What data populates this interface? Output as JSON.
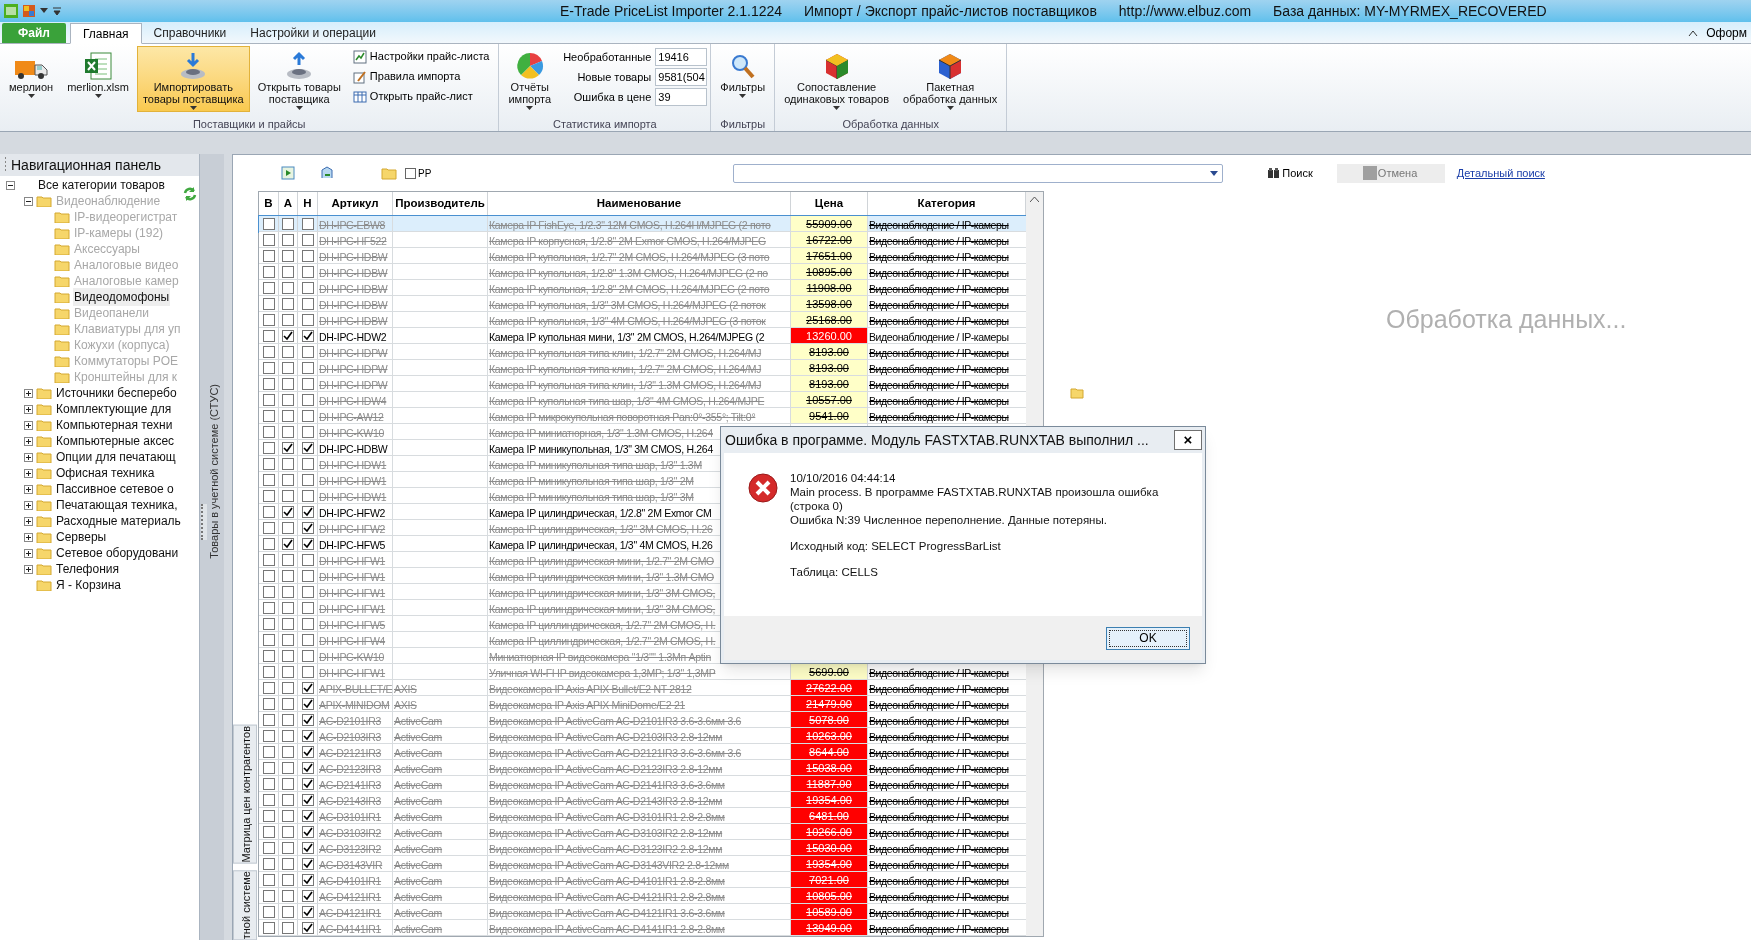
{
  "window": {
    "title_parts": [
      "E-Trade PriceList Importer 2.1.1224",
      "Импорт / Экспорт прайс-листов поставщиков",
      "http://www.elbuz.com",
      "База данных: MY-MYRMEX_RECOVERED"
    ]
  },
  "ribbon_tabs": [
    {
      "label": "Файл",
      "kind": "file",
      "selected": false
    },
    {
      "label": "Главная",
      "kind": "tab",
      "selected": true
    },
    {
      "label": "Справочники",
      "kind": "tab",
      "selected": false
    },
    {
      "label": "Настройки и операции",
      "kind": "tab",
      "selected": false
    }
  ],
  "ribbon_right": "Оформ",
  "ribbon_groups": [
    {
      "label": "Поставщики и прайсы",
      "items": [
        {
          "kind": "large",
          "label": "мерлион",
          "dropdown": true,
          "highlighted": false
        },
        {
          "kind": "large",
          "label": "merlion.xlsm",
          "dropdown": true,
          "highlighted": false
        },
        {
          "kind": "large",
          "label": "Импортировать\nтовары поставщика",
          "dropdown": true,
          "highlighted": true
        },
        {
          "kind": "large",
          "label": "Открыть товары\nпоставщика",
          "dropdown": true,
          "highlighted": false
        },
        {
          "kind": "small_stack",
          "entries": [
            "Настройки прайс-листа",
            "Правила импорта",
            "Открыть прайс-лист"
          ]
        }
      ]
    },
    {
      "label": "Статистика импорта",
      "items": [
        {
          "kind": "large",
          "label": "Отчёты\nимпорта",
          "dropdown": true,
          "highlighted": false
        },
        {
          "kind": "stats",
          "fields": [
            {
              "label": "Необработанные",
              "value": "19416"
            },
            {
              "label": "Новые товары",
              "value": "9581(504"
            },
            {
              "label": "Ошибка в цене",
              "value": "39"
            }
          ]
        }
      ]
    },
    {
      "label": "Фильтры",
      "items": [
        {
          "kind": "large",
          "label": "Фильтры",
          "dropdown": true,
          "highlighted": false
        }
      ]
    },
    {
      "label": "Обработка данных",
      "items": [
        {
          "kind": "large",
          "label": "Сопоставление\nодинаковых товаров",
          "dropdown": true,
          "highlighted": false
        },
        {
          "kind": "large",
          "label": "Пакетная\nобработка данных",
          "dropdown": true,
          "highlighted": false
        }
      ]
    }
  ],
  "nav": {
    "title": "Навигационная панель",
    "tree": [
      {
        "label": "Все категории товаров",
        "kind": "group",
        "expanded": true,
        "disabled": false,
        "selected": false,
        "children": [
          {
            "label": "Видеонаблюдение",
            "kind": "group",
            "expanded": true,
            "disabled": true,
            "selected": false,
            "children": [
              {
                "label": "IP-видеорегистрат",
                "kind": "leaf",
                "disabled": true,
                "selected": false
              },
              {
                "label": "IP-камеры (192)",
                "kind": "leaf",
                "disabled": true,
                "selected": false
              },
              {
                "label": "Аксессуары",
                "kind": "leaf",
                "disabled": true,
                "selected": false
              },
              {
                "label": "Аналоговые видео",
                "kind": "leaf",
                "disabled": true,
                "selected": false
              },
              {
                "label": "Аналоговые камер",
                "kind": "leaf",
                "disabled": true,
                "selected": false
              },
              {
                "label": "Видеодомофоны",
                "kind": "leaf",
                "disabled": false,
                "selected": true
              },
              {
                "label": "Видеопанели",
                "kind": "leaf",
                "disabled": true,
                "selected": false
              },
              {
                "label": "Клавиатуры для уп",
                "kind": "leaf",
                "disabled": true,
                "selected": false
              },
              {
                "label": "Кожухи (корпуса)",
                "kind": "leaf",
                "disabled": true,
                "selected": false
              },
              {
                "label": "Коммутаторы POE",
                "kind": "leaf",
                "disabled": true,
                "selected": false
              },
              {
                "label": "Кронштейны для к",
                "kind": "leaf",
                "disabled": true,
                "selected": false
              }
            ]
          },
          {
            "label": "Источники бесперебо",
            "kind": "group",
            "expanded": false,
            "disabled": false,
            "selected": false
          },
          {
            "label": "Комплектующие для",
            "kind": "group",
            "expanded": false,
            "disabled": false,
            "selected": false
          },
          {
            "label": "Компьютерная техни",
            "kind": "group",
            "expanded": false,
            "disabled": false,
            "selected": false
          },
          {
            "label": "Компьютерные аксес",
            "kind": "group",
            "expanded": false,
            "disabled": false,
            "selected": false
          },
          {
            "label": "Опции для печатающ",
            "kind": "group",
            "expanded": false,
            "disabled": false,
            "selected": false
          },
          {
            "label": "Офисная техника",
            "kind": "group",
            "expanded": false,
            "disabled": false,
            "selected": false
          },
          {
            "label": "Пассивное сетевое о",
            "kind": "group",
            "expanded": false,
            "disabled": false,
            "selected": false
          },
          {
            "label": "Печатающая техника,",
            "kind": "group",
            "expanded": false,
            "disabled": false,
            "selected": false
          },
          {
            "label": "Расходные материаль",
            "kind": "group",
            "expanded": false,
            "disabled": false,
            "selected": false
          },
          {
            "label": "Серверы",
            "kind": "group",
            "expanded": false,
            "disabled": false,
            "selected": false
          },
          {
            "label": "Сетевое оборудовани",
            "kind": "group",
            "expanded": false,
            "disabled": false,
            "selected": false
          },
          {
            "label": "Телефония",
            "kind": "group",
            "expanded": false,
            "disabled": false,
            "selected": false
          },
          {
            "label": "Я - Корзина",
            "kind": "leaf",
            "disabled": false,
            "selected": false
          }
        ]
      }
    ]
  },
  "splitter_label": "Товары в учетной системе (СТУС)",
  "side_tabs": [
    "Матрица цен контрагентов",
    "тной системе"
  ],
  "toolbar": {
    "checkbox": {
      "label": "PP",
      "checked": false
    },
    "search_button": "Поиск",
    "cancel_button": {
      "label": "Отмена",
      "disabled": true
    },
    "detail_link": "Детальный поиск"
  },
  "table": {
    "columns": [
      "В",
      "А",
      "Н",
      "Артикул",
      "Производитель",
      "Наименование",
      "Цена",
      "Категория"
    ],
    "rows": [
      {
        "b": false,
        "a": false,
        "h": false,
        "article": "DH-IPC-EBW8",
        "name": "Камера IP FishEye, 1/2.3\" 12M CMOS, H.264H/MJPEG (2 пото",
        "price": "55909.00",
        "price_error": false,
        "category": "Видеонаблюдение / IP-камеры",
        "struck": true,
        "selected": true
      },
      {
        "b": false,
        "a": false,
        "h": false,
        "article": "DH-IPC-HF522",
        "name": "Камера IP корпусная, 1/2.8\" 2M Exmor CMOS, H.264/MJPEG",
        "price": "16722.00",
        "price_error": false,
        "category": "Видеонаблюдение / IP-камеры",
        "struck": true,
        "selected": false
      },
      {
        "b": false,
        "a": false,
        "h": false,
        "article": "DH-IPC-HDBW",
        "name": "Камера IP купольная, 1/2.7\" 2M CMOS, H.264/MJPEG (3 пото",
        "price": "17651.00",
        "price_error": false,
        "category": "Видеонаблюдение / IP-камеры",
        "struck": true,
        "selected": false
      },
      {
        "b": false,
        "a": false,
        "h": false,
        "article": "DH-IPC-HDBW",
        "name": "Камера IP купольная, 1/2.8\" 1.3M CMOS, H.264/MJPEG (2 по",
        "price": "10895.00",
        "price_error": false,
        "category": "Видеонаблюдение / IP-камеры",
        "struck": true,
        "selected": false
      },
      {
        "b": false,
        "a": false,
        "h": false,
        "article": "DH-IPC-HDBW",
        "name": "Камера IP купольная, 1/2.8\" 2M CMOS, H.264/MJPEG (2 пото",
        "price": "11908.00",
        "price_error": false,
        "category": "Видеонаблюдение / IP-камеры",
        "struck": true,
        "selected": false
      },
      {
        "b": false,
        "a": false,
        "h": false,
        "article": "DH-IPC-HDBW",
        "name": "Камера IP купольная, 1/3\" 3M CMOS, H.264/MJPEG (2 поток",
        "price": "13598.00",
        "price_error": false,
        "category": "Видеонаблюдение / IP-камеры",
        "struck": true,
        "selected": false
      },
      {
        "b": false,
        "a": false,
        "h": false,
        "article": "DH-IPC-HDBW",
        "name": "Камера IP купольная, 1/3\" 4M CMOS, H.264/MJPEG (3 поток",
        "price": "25168.00",
        "price_error": false,
        "category": "Видеонаблюдение / IP-камеры",
        "struck": true,
        "selected": false
      },
      {
        "b": false,
        "a": true,
        "h": true,
        "article": "DH-IPC-HDW2",
        "name": "Камера IP купольная мини, 1/3\" 2M CMOS, H.264/MJPEG (2",
        "price": "13260.00",
        "price_error": true,
        "category": "Видеонаблюдение / IP-камеры",
        "struck": false,
        "selected": false
      },
      {
        "b": false,
        "a": false,
        "h": false,
        "article": "DH-IPC-HDPW",
        "name": "Камера IP купольная типа клин, 1/2.7\" 2M CMOS, H.264/MJ",
        "price": "8193.00",
        "price_error": false,
        "category": "Видеонаблюдение / IP-камеры",
        "struck": true,
        "selected": false
      },
      {
        "b": false,
        "a": false,
        "h": false,
        "article": "DH-IPC-HDPW",
        "name": "Камера IP купольная типа клин, 1/2.7\" 2M CMOS, H.264/MJ",
        "price": "8193.00",
        "price_error": false,
        "category": "Видеонаблюдение / IP-камеры",
        "struck": true,
        "selected": false
      },
      {
        "b": false,
        "a": false,
        "h": false,
        "article": "DH-IPC-HDPW",
        "name": "Камера IP купольная типа клин, 1/3\" 1.3M CMOS, H.264/MJ",
        "price": "8193.00",
        "price_error": false,
        "category": "Видеонаблюдение / IP-камеры",
        "struck": true,
        "selected": false
      },
      {
        "b": false,
        "a": false,
        "h": false,
        "article": "DH-IPC-HDW4",
        "name": "Камера IP купольная типа шар, 1/3\" 4M CMOS, H.264/MJPE",
        "price": "10557.00",
        "price_error": false,
        "category": "Видеонаблюдение / IP-камеры",
        "struck": true,
        "selected": false
      },
      {
        "b": false,
        "a": false,
        "h": false,
        "article": "DH-IPC-AW12",
        "name": "Камера IP микрокупольная поворотная Pan:0°-355°; Tilt:0°",
        "price": "9541.00",
        "price_error": false,
        "category": "Видеонаблюдение / IP-камеры",
        "struck": true,
        "selected": false
      },
      {
        "b": false,
        "a": false,
        "h": false,
        "article": "DH-IPC-KW10",
        "name": "Камера IP миниатюрная, 1/3\" 1.3M CMOS, H.264",
        "struck": true,
        "selected": false
      },
      {
        "b": false,
        "a": true,
        "h": true,
        "article": "DH-IPC-HDBW",
        "name": "Камера IP миникупольная, 1/3\" 3M CMOS, H.264",
        "struck": false,
        "selected": false
      },
      {
        "b": false,
        "a": false,
        "h": false,
        "article": "DH-IPC-HDW1",
        "name": "Камера IP миникупольная типа шар, 1/3\" 1.3M",
        "struck": true,
        "selected": false
      },
      {
        "b": false,
        "a": false,
        "h": false,
        "article": "DH-IPC-HDW1",
        "name": "Камера IP миникупольная типа шар, 1/3\" 2M",
        "struck": true,
        "selected": false
      },
      {
        "b": false,
        "a": false,
        "h": false,
        "article": "DH-IPC-HDW1",
        "name": "Камера IP миникупольная типа шар, 1/3\" 3M",
        "struck": true,
        "selected": false
      },
      {
        "b": false,
        "a": true,
        "h": true,
        "article": "DH-IPC-HFW2",
        "name": "Камера IP цилиндрическая, 1/2.8\" 2M Exmor CM",
        "struck": false,
        "selected": false
      },
      {
        "b": false,
        "a": false,
        "h": true,
        "article": "DH-IPC-HFW2",
        "name": "Камера IP цилиндрическая, 1/3\" 3M CMOS, H.26",
        "struck": true,
        "selected": false
      },
      {
        "b": false,
        "a": true,
        "h": true,
        "article": "DH-IPC-HFW5",
        "name": "Камера IP цилиндрическая, 1/3\" 4M CMOS, H.26",
        "struck": false,
        "selected": false
      },
      {
        "b": false,
        "a": false,
        "h": false,
        "article": "DH-IPC-HFW1",
        "name": "Камера IP цилиндрическая мини, 1/2.7\" 2M CMO",
        "struck": true,
        "selected": false
      },
      {
        "b": false,
        "a": false,
        "h": false,
        "article": "DH-IPC-HFW1",
        "name": "Камера IP цилиндрическая мини, 1/3\" 1.3M CMO",
        "struck": true,
        "selected": false
      },
      {
        "b": false,
        "a": false,
        "h": false,
        "article": "DH-IPC-HFW1",
        "name": "Камера IP цилиндрическая мини, 1/3\" 3M CMOS,",
        "struck": true,
        "selected": false
      },
      {
        "b": false,
        "a": false,
        "h": false,
        "article": "DH-IPC-HFW1",
        "name": "Камера IP цилиндрическая мини, 1/3\" 3M CMOS,",
        "struck": true,
        "selected": false
      },
      {
        "b": false,
        "a": false,
        "h": false,
        "article": "DH-IPC-HFW5",
        "name": "Камера IP циллиндрическая, 1/2.7\" 2M CMOS, H.",
        "struck": true,
        "selected": false
      },
      {
        "b": false,
        "a": false,
        "h": false,
        "article": "DH-IPC-HFW4",
        "name": "Камера IP циллиндрическая, 1/2.7\" 2M CMOS, H.",
        "struck": true,
        "selected": false
      },
      {
        "b": false,
        "a": false,
        "h": false,
        "article": "DH-IPC-KW10",
        "name": "Миниатюрная IP видеокамера \"1/3\"\" 1.3Мп Aptin",
        "struck": true,
        "selected": false
      },
      {
        "b": false,
        "a": false,
        "h": false,
        "article": "DH-IPC-HFW1",
        "name": "Уличная WI-FI IP видеокамера 1,3MP; 1/3\" 1,3MP",
        "price": "5699.00",
        "price_error": false,
        "category": "Видеонаблюдение / IP-камеры",
        "struck": true,
        "selected": false
      },
      {
        "b": false,
        "a": false,
        "h": true,
        "article": "APIX-BULLET/E",
        "maker": "AXIS",
        "name": "Видеокамера IP Axis APIX Bullet/E2 NT 2812",
        "price": "27622.00",
        "price_error": true,
        "category": "Видеонаблюдение / IP-камеры",
        "struck": true,
        "selected": false
      },
      {
        "b": false,
        "a": false,
        "h": true,
        "article": "APIX-MINIDOM",
        "maker": "AXIS",
        "name": "Видеокамера IP Axis APIX MiniDome/E2 21",
        "price": "21479.00",
        "price_error": true,
        "category": "Видеонаблюдение / IP-камеры",
        "struck": true,
        "selected": false
      },
      {
        "b": false,
        "a": false,
        "h": true,
        "article": "AC-D2101IR3",
        "maker": "ActiveCam",
        "name": "Видеокамера IP ActiveCam AC-D2101IR3 3.6-3.6мм 3.6",
        "price": "5078.00",
        "price_error": true,
        "category": "Видеонаблюдение / IP-камеры",
        "struck": true,
        "selected": false
      },
      {
        "b": false,
        "a": false,
        "h": true,
        "article": "AC-D2103IR3",
        "maker": "ActiveCam",
        "name": "Видеокамера IP ActiveCam AC-D2103IR3 2.8-12мм",
        "price": "10263.00",
        "price_error": true,
        "category": "Видеонаблюдение / IP-камеры",
        "struck": true,
        "selected": false
      },
      {
        "b": false,
        "a": false,
        "h": true,
        "article": "AC-D2121IR3",
        "maker": "ActiveCam",
        "name": "Видеокамера IP ActiveCam AC-D2121IR3 3.6-3.6мм 3.6",
        "price": "8644.00",
        "price_error": true,
        "category": "Видеонаблюдение / IP-камеры",
        "struck": true,
        "selected": false
      },
      {
        "b": false,
        "a": false,
        "h": true,
        "article": "AC-D2123IR3",
        "maker": "ActiveCam",
        "name": "Видеокамера IP ActiveCam AC-D2123IR3 2.8-12мм",
        "price": "15038.00",
        "price_error": true,
        "category": "Видеонаблюдение / IP-камеры",
        "struck": true,
        "selected": false
      },
      {
        "b": false,
        "a": false,
        "h": true,
        "article": "AC-D2141IR3",
        "maker": "ActiveCam",
        "name": "Видеокамера IP ActiveCam AC-D2141IR3 3.6-3.6мм",
        "price": "11887.00",
        "price_error": true,
        "category": "Видеонаблюдение / IP-камеры",
        "struck": true,
        "selected": false
      },
      {
        "b": false,
        "a": false,
        "h": true,
        "article": "AC-D2143IR3",
        "maker": "ActiveCam",
        "name": "Видеокамера IP ActiveCam AC-D2143IR3 2.8-12мм",
        "price": "19354.00",
        "price_error": true,
        "category": "Видеонаблюдение / IP-камеры",
        "struck": true,
        "selected": false
      },
      {
        "b": false,
        "a": false,
        "h": true,
        "article": "AC-D3101IR1",
        "maker": "ActiveCam",
        "name": "Видеокамера IP ActiveCam AC-D3101IR1 2.8-2.8мм",
        "price": "6481.00",
        "price_error": true,
        "category": "Видеонаблюдение / IP-камеры",
        "struck": true,
        "selected": false
      },
      {
        "b": false,
        "a": false,
        "h": true,
        "article": "AC-D3103IR2",
        "maker": "ActiveCam",
        "name": "Видеокамера IP ActiveCam AC-D3103IR2 2.8-12мм",
        "price": "10266.00",
        "price_error": true,
        "category": "Видеонаблюдение / IP-камеры",
        "struck": true,
        "selected": false
      },
      {
        "b": false,
        "a": false,
        "h": true,
        "article": "AC-D3123IR2",
        "maker": "ActiveCam",
        "name": "Видеокамера IP ActiveCam AC-D3123IR2 2.8-12мм",
        "price": "15030.00",
        "price_error": true,
        "category": "Видеонаблюдение / IP-камеры",
        "struck": true,
        "selected": false
      },
      {
        "b": false,
        "a": false,
        "h": true,
        "article": "AC-D3143VIR",
        "maker": "ActiveCam",
        "name": "Видеокамера IP ActiveCam AC-D3143VIR2 2.8-12мм",
        "price": "19354.00",
        "price_error": true,
        "category": "Видеонаблюдение / IP-камеры",
        "struck": true,
        "selected": false
      },
      {
        "b": false,
        "a": false,
        "h": true,
        "article": "AC-D4101IR1",
        "maker": "ActiveCam",
        "name": "Видеокамера IP ActiveCam AC-D4101IR1 2.8-2.8мм",
        "price": "7021.00",
        "price_error": true,
        "category": "Видеонаблюдение / IP-камеры",
        "struck": true,
        "selected": false
      },
      {
        "b": false,
        "a": false,
        "h": true,
        "article": "AC-D4121IR1",
        "maker": "ActiveCam",
        "name": "Видеокамера IP ActiveCam AC-D4121IR1 2.8-2.8мм",
        "price": "10805.00",
        "price_error": true,
        "category": "Видеонаблюдение / IP-камеры",
        "struck": true,
        "selected": false
      },
      {
        "b": false,
        "a": false,
        "h": true,
        "article": "AC-D4121IR1",
        "maker": "ActiveCam",
        "name": "Видеокамера IP ActiveCam AC-D4121IR1 3.6-3.6мм",
        "price": "10589.00",
        "price_error": true,
        "category": "Видеонаблюдение / IP-камеры",
        "struck": true,
        "selected": false
      },
      {
        "b": false,
        "a": false,
        "h": true,
        "article": "AC-D4141IR1",
        "maker": "ActiveCam",
        "name": "Видеокамера IP ActiveCam AC-D4141IR1 2.8-2.8мм",
        "price": "13949.00",
        "price_error": true,
        "category": "Видеонаблюдение / IP-камеры",
        "struck": true,
        "selected": false
      }
    ]
  },
  "status_text": "Обработка данных...",
  "dialog": {
    "title": "Ошибка в программе. Модуль FASTXTAB.RUNXTAB выполнил ...",
    "close": "×",
    "paragraphs": [
      [
        "10/10/2016 04:44:14",
        "Main process. В программе FASTXTAB.RUNXTAB произошла ошибка (строка 0)",
        "Ошибка N:39 Численное переполнение. Данные потеряны."
      ],
      [
        "Исходный код: SELECT ProgressBarList"
      ],
      [
        "Таблица: CELLS"
      ]
    ],
    "button": "OK"
  }
}
